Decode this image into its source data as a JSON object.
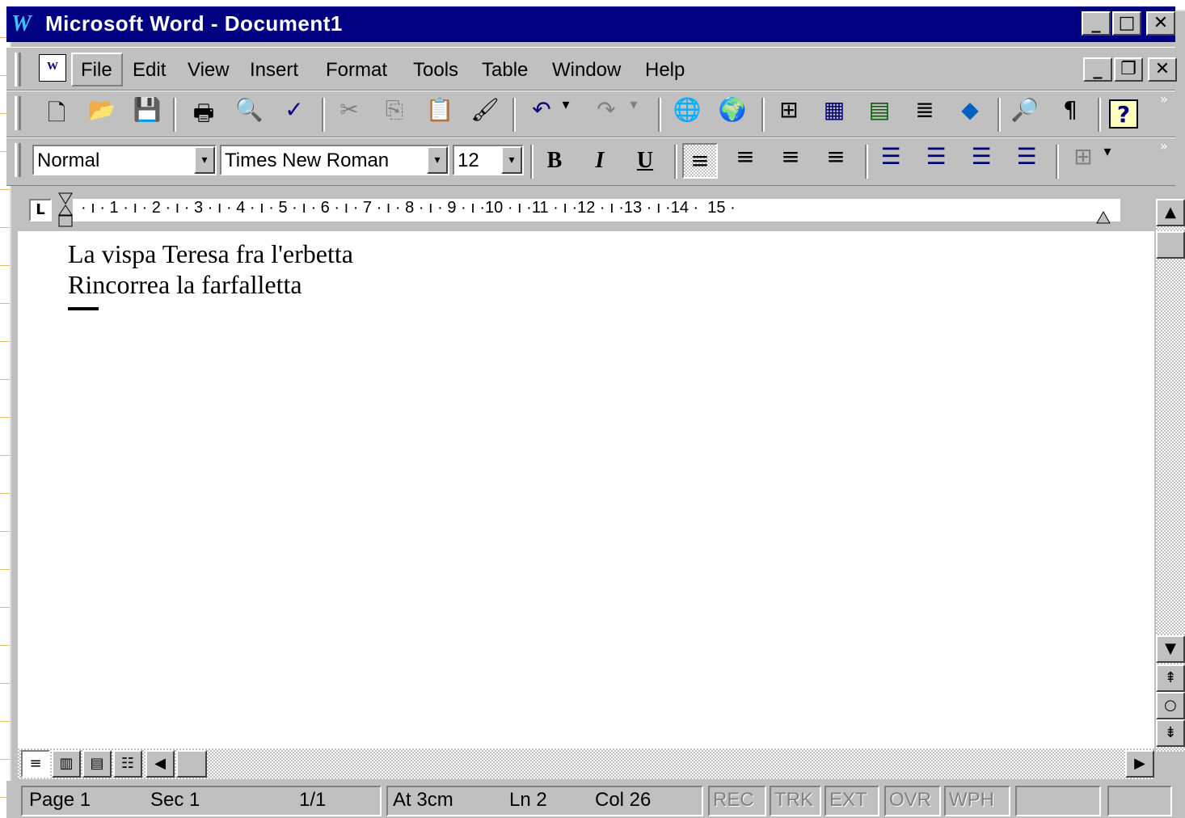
{
  "window": {
    "logo": "W",
    "title": "Microsoft Word - Document1",
    "caption_buttons": {
      "minimize": "_",
      "maximize": "□",
      "close": "✕"
    },
    "doc_buttons": {
      "minimize": "_",
      "restore": "❐",
      "close": "✕"
    }
  },
  "menu": {
    "items": [
      "File",
      "Edit",
      "View",
      "Insert",
      "Format",
      "Tools",
      "Table",
      "Window",
      "Help"
    ]
  },
  "standard_toolbar": {
    "icons": [
      "new-icon",
      "open-icon",
      "save-icon",
      "print-icon",
      "print-preview-icon",
      "spelling-icon",
      "cut-icon",
      "copy-icon",
      "paste-icon",
      "format-painter-icon",
      "undo-icon",
      "redo-icon",
      "insert-hyperlink-icon",
      "web-toolbar-icon",
      "tables-borders-icon",
      "insert-table-icon",
      "insert-excel-icon",
      "columns-icon",
      "drawing-icon",
      "document-map-icon",
      "show-hide-icon",
      "help-icon"
    ],
    "glyphs": {
      "new": "🗋",
      "open": "📂",
      "save": "💾",
      "print": "🖶",
      "preview": "🔍",
      "spelling": "✓",
      "cut": "✂",
      "copy": "⎘",
      "paste": "📋",
      "painter": "🖌",
      "undo": "↶",
      "redo": "↷",
      "hyperlink": "🌐",
      "web": "🌍",
      "tables": "⊞",
      "table": "▦",
      "excel": "▤",
      "columns": "≣",
      "drawing": "◆",
      "docmap": "🔎",
      "pilcrow": "¶",
      "help": "?",
      "dropdown": "▾",
      "more": "»"
    }
  },
  "formatting_toolbar": {
    "style": "Normal",
    "font": "Times New Roman",
    "size": "12",
    "bold": "B",
    "italic": "I",
    "underline": "U",
    "align_glyph": "≡",
    "list_glyph": "☰",
    "border_glyph": "⊞"
  },
  "ruler": {
    "tab_selector": "L",
    "labels": "· ı · 1 · ı · 2 · ı · 3 · ı · 4 · ı · 5 · ı · 6 · ı · 7 · ı · 8 · ı · 9 · ı ·10 · ı ·11 · ı ·12 · ı ·13 · ı ·14 ·  15 ·"
  },
  "document": {
    "lines": [
      "La vispa Teresa fra l'erbetta",
      "Rincorrea la farfalletta"
    ]
  },
  "scrollbars": {
    "up": "▲",
    "down": "▼",
    "prev_page": "⇞",
    "select_browse": "○",
    "next_page": "⇟",
    "left": "◀",
    "right": "▶"
  },
  "view_buttons": [
    "≡",
    "▥",
    "▤",
    "☷"
  ],
  "status": {
    "page": "Page  1",
    "sec": "Sec  1",
    "pages": "1/1",
    "at": "At  3cm",
    "ln": "Ln  2",
    "col": "Col  26",
    "indicators": [
      "REC",
      "TRK",
      "EXT",
      "OVR",
      "WPH"
    ]
  }
}
